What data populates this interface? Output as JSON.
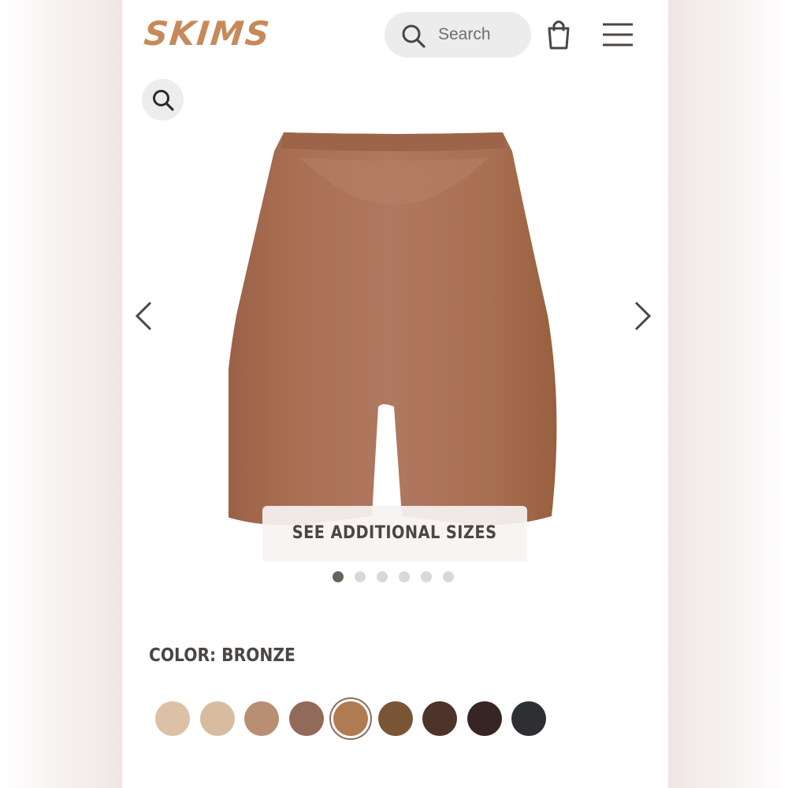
{
  "header": {
    "logo_text": "SKIMS",
    "search_placeholder": "Search"
  },
  "icons": {
    "search": "search-icon",
    "bag": "shopping-bag-icon",
    "menu": "hamburger-menu-icon",
    "zoom": "zoom-search-icon",
    "prev": "chevron-left-icon",
    "next": "chevron-right-icon"
  },
  "product": {
    "image_alt": "Bronze shorts",
    "see_sizes_label": "SEE ADDITIONAL SIZES",
    "image_count": 6,
    "active_image": 1
  },
  "color": {
    "label": "COLOR: BRONZE",
    "swatches": [
      {
        "name": "swatch-1",
        "hex": "#dcc1a6"
      },
      {
        "name": "swatch-2",
        "hex": "#d8bc9f"
      },
      {
        "name": "swatch-3",
        "hex": "#b98f74"
      },
      {
        "name": "swatch-4",
        "hex": "#93695a"
      },
      {
        "name": "swatch-bronze",
        "hex": "#b07a52",
        "selected": true
      },
      {
        "name": "swatch-6",
        "hex": "#7a5535"
      },
      {
        "name": "swatch-7",
        "hex": "#4d3329"
      },
      {
        "name": "swatch-8",
        "hex": "#362522"
      },
      {
        "name": "swatch-9",
        "hex": "#2e2f33"
      }
    ]
  },
  "colors": {
    "brand": "#c68a5a",
    "product": "#a86f52"
  }
}
